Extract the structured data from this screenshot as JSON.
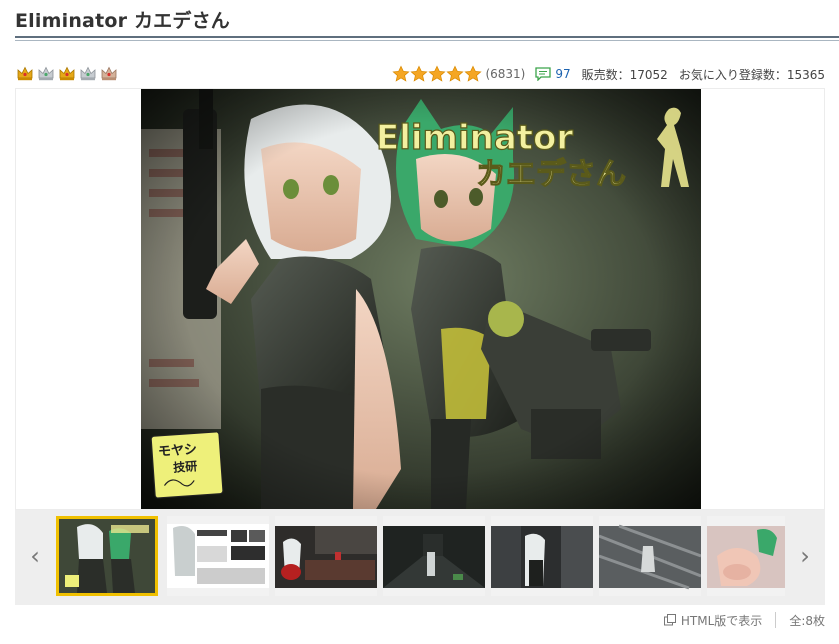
{
  "title": "Eliminator カエデさん",
  "rank_crowns": [
    {
      "icon": "gold-crown-icon",
      "color": "#e6a817"
    },
    {
      "icon": "silver-crown-icon",
      "color": "#b9bec4"
    },
    {
      "icon": "gold-crown-icon",
      "color": "#e6a817"
    },
    {
      "icon": "silver-crown-icon",
      "color": "#b9bec4"
    },
    {
      "icon": "bronze-crown-icon",
      "color": "#c9a48a"
    }
  ],
  "stats": {
    "rating": 5,
    "rating_count": "(6831)",
    "review_count": "97",
    "sales_label": "販売数：17052",
    "favorites_label": "お気に入り登録数：15365"
  },
  "main_image": {
    "logo_line1": "Eliminator",
    "logo_line2": "カエデさん",
    "stamp_line1": "モヤシ",
    "stamp_line2": "技研"
  },
  "thumbnails": {
    "count": 7,
    "selected_index": 0,
    "prev_label": "‹",
    "next_label": "›"
  },
  "footer": {
    "html_view": "HTML版で表示",
    "total": "全:8枚"
  },
  "colors": {
    "accent_blue": "#1d63b0",
    "selected_border": "#f0c000",
    "star": "#f5a623"
  }
}
